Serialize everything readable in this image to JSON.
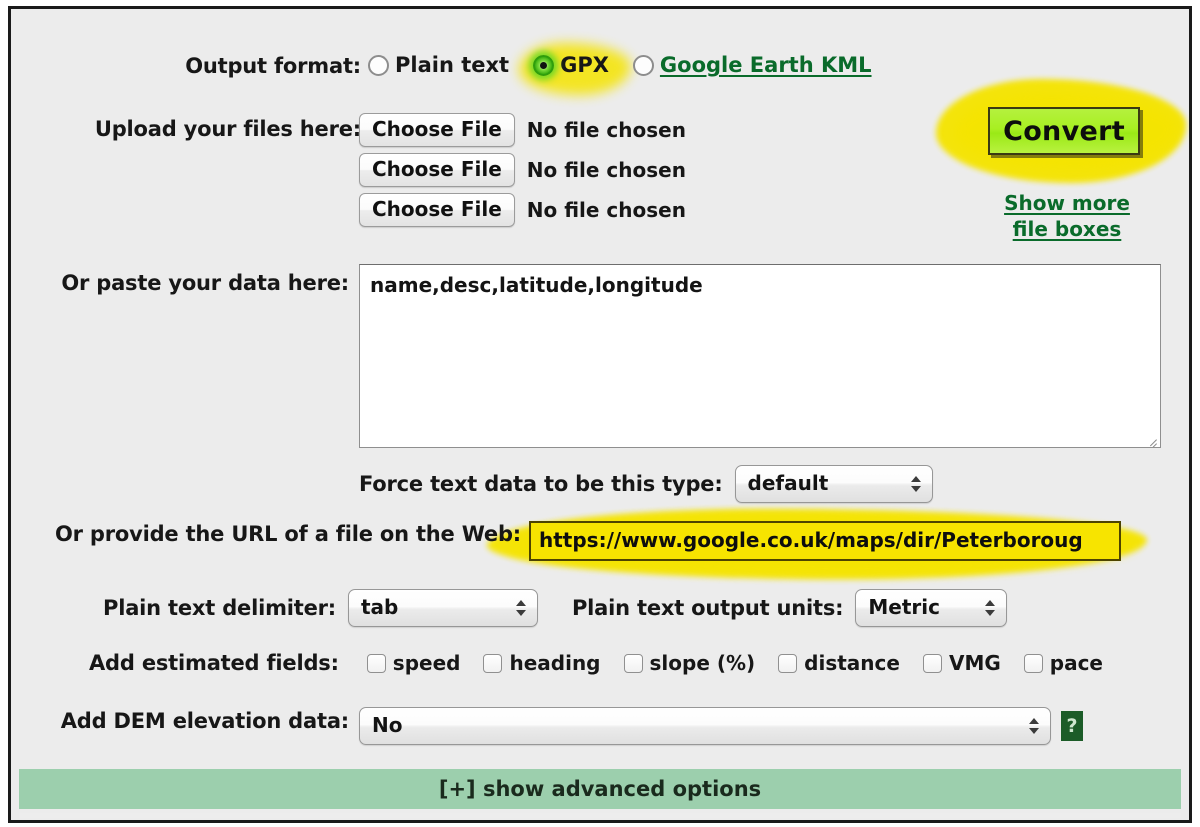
{
  "form": {
    "output_format": {
      "label": "Output format:",
      "options": [
        {
          "id": "plain-text",
          "label": "Plain text",
          "selected": false,
          "is_link": false,
          "highlighted": false
        },
        {
          "id": "gpx",
          "label": "GPX",
          "selected": true,
          "is_link": false,
          "highlighted": true
        },
        {
          "id": "google-earth-kml",
          "label": "Google Earth KML",
          "selected": false,
          "is_link": true,
          "highlighted": false
        }
      ]
    },
    "upload": {
      "label": "Upload your files here:",
      "button_label": "Choose File",
      "status_text": "No file chosen",
      "rows": 3
    },
    "convert": {
      "button_label": "Convert",
      "show_more_line1": "Show more",
      "show_more_line2": "file boxes"
    },
    "paste": {
      "label": "Or paste your data here:",
      "value": "name,desc,latitude,longitude"
    },
    "force_type": {
      "label": "Force text data to be this type:",
      "value": "default"
    },
    "url": {
      "label": "Or provide the URL of a file on the Web:",
      "value": "https://www.google.co.uk/maps/dir/Peterboroug",
      "highlighted": true
    },
    "delimiter": {
      "label": "Plain text delimiter:",
      "value": "tab"
    },
    "output_units": {
      "label": "Plain text output units:",
      "value": "Metric"
    },
    "estimated_fields": {
      "label": "Add estimated fields:",
      "items": [
        {
          "label": "speed",
          "checked": false
        },
        {
          "label": "heading",
          "checked": false
        },
        {
          "label": "slope (%)",
          "checked": false
        },
        {
          "label": "distance",
          "checked": false
        },
        {
          "label": "VMG",
          "checked": false
        },
        {
          "label": "pace",
          "checked": false
        }
      ]
    },
    "dem": {
      "label": "Add DEM elevation data:",
      "value": "No",
      "help_glyph": "?"
    },
    "advanced": {
      "label": "[+] show advanced options"
    }
  },
  "colors": {
    "page_background": "#ececec",
    "highlighter_yellow": "#f5e400",
    "convert_green": "#a8ef22",
    "link_green": "#0a6b2b",
    "advanced_bar_green": "#9ccfad",
    "help_icon_green": "#1c5c28",
    "radio_selected_green": "#39ad10",
    "url_field_yellow": "#f7e400"
  }
}
